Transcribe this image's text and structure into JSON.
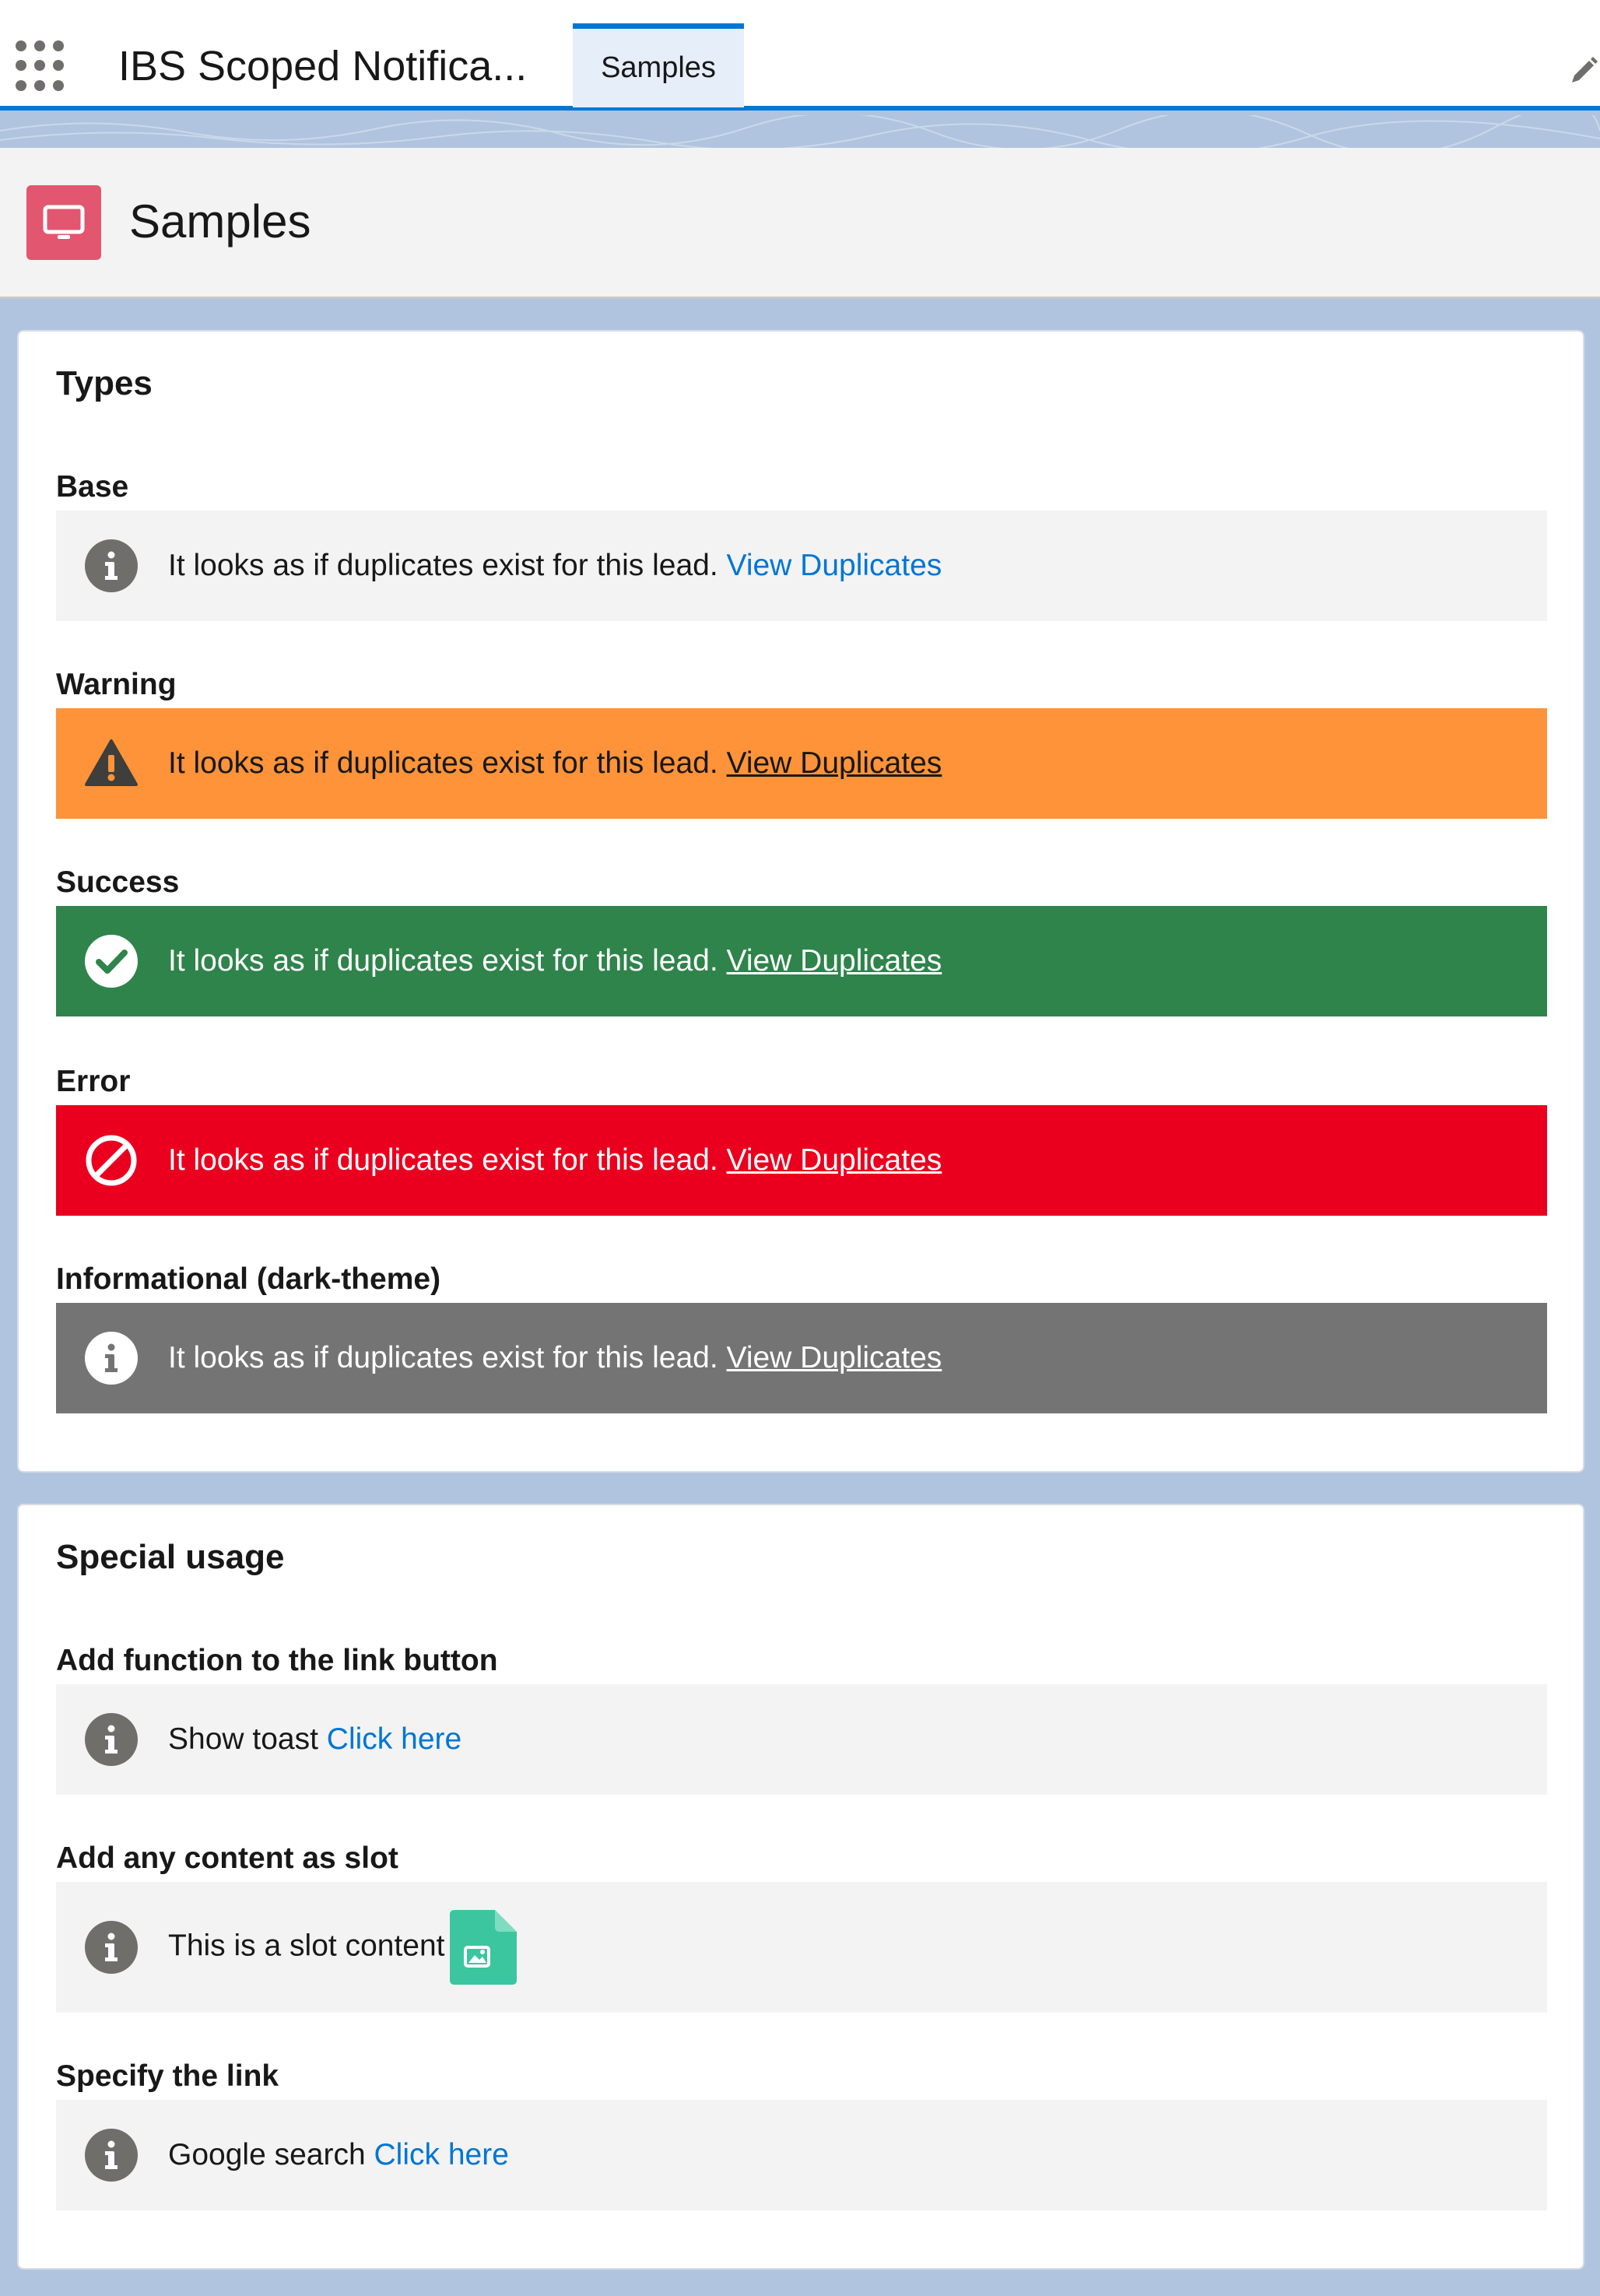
{
  "header": {
    "app_name": "IBS Scoped Notifica...",
    "tab_label": "Samples"
  },
  "page": {
    "title": "Samples"
  },
  "types_card": {
    "title": "Types",
    "sections": [
      {
        "label": "Base",
        "variant": "base",
        "icon": "info-icon",
        "message": "It looks as if duplicates exist for this lead.",
        "link": "View Duplicates",
        "color": "#f3f3f3"
      },
      {
        "label": "Warning",
        "variant": "warning",
        "icon": "warning-icon",
        "message": "It looks as if duplicates exist for this lead.",
        "link": "View Duplicates",
        "color": "#fe9339"
      },
      {
        "label": "Success",
        "variant": "success",
        "icon": "success-check-icon",
        "message": "It looks as if duplicates exist for this lead.",
        "link": "View Duplicates",
        "color": "#2e844a"
      },
      {
        "label": "Error",
        "variant": "error",
        "icon": "error-ban-icon",
        "message": "It looks as if duplicates exist for this lead.",
        "link": "View Duplicates",
        "color": "#ea001e"
      },
      {
        "label": "Informational (dark-theme)",
        "variant": "info-dark",
        "icon": "info-icon",
        "message": "It looks as if duplicates exist for this lead.",
        "link": "View Duplicates",
        "color": "#747474"
      }
    ]
  },
  "special_card": {
    "title": "Special usage",
    "sections": [
      {
        "label": "Add function to the link button",
        "message": "Show toast",
        "link": "Click here"
      },
      {
        "label": "Add any content as slot",
        "message": "This is a slot content",
        "slot_icon": "image-file-icon"
      },
      {
        "label": "Specify the link",
        "message": "Google search",
        "link": "Click here"
      }
    ]
  },
  "colors": {
    "brand": "#0176d3",
    "page_icon": "#e3566f",
    "background": "#b0c4df",
    "slot_file": "#3bc6a0"
  }
}
